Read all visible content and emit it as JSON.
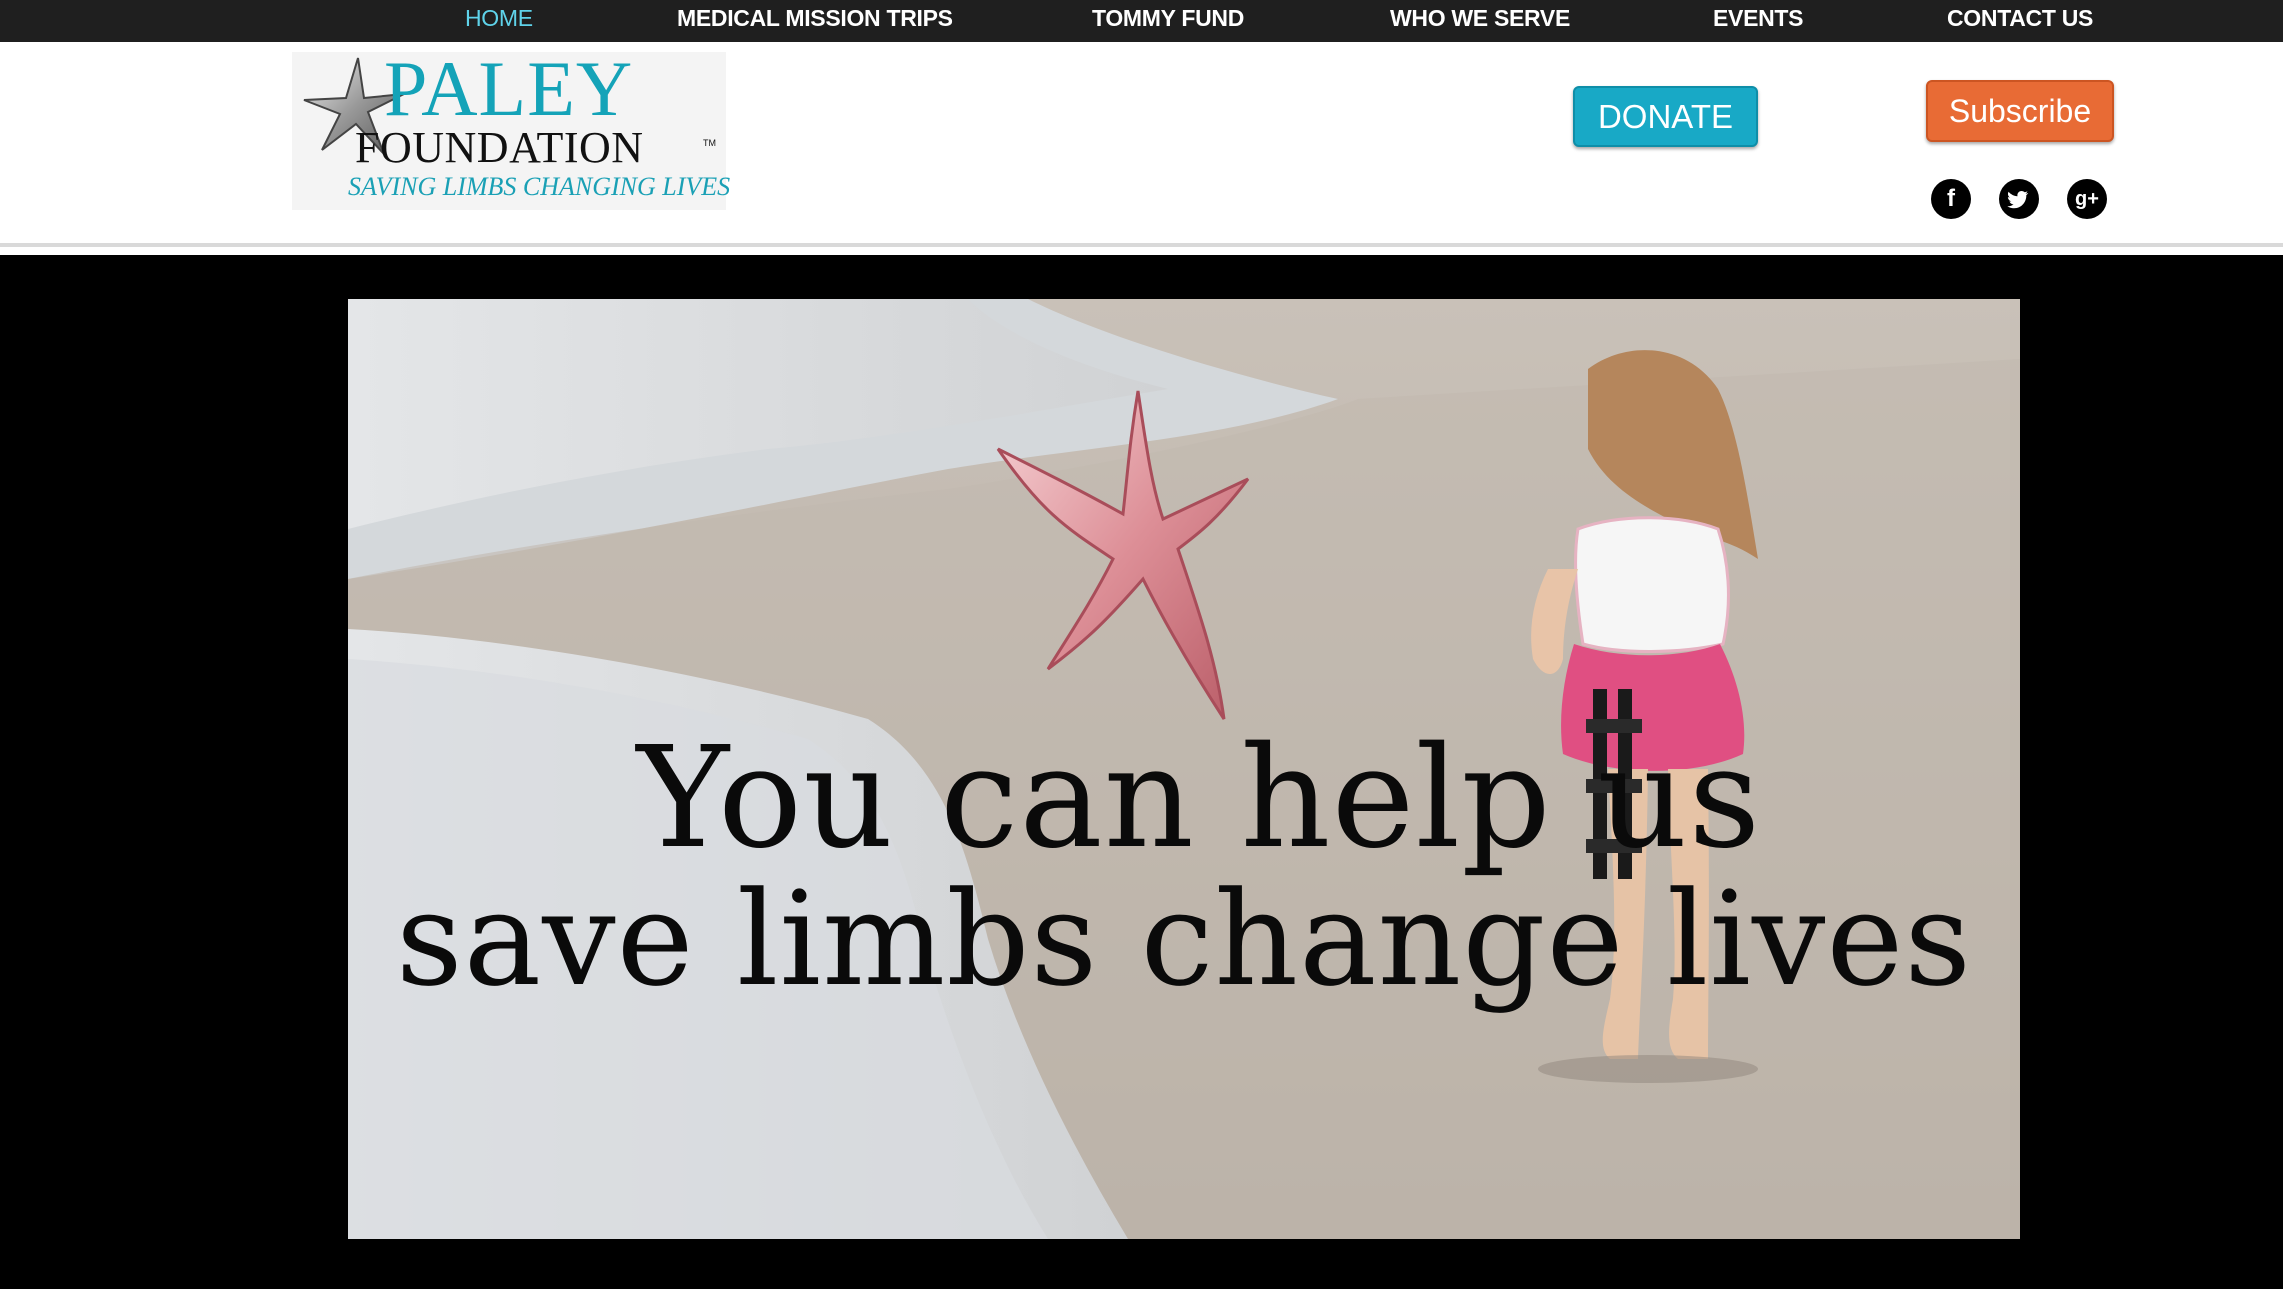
{
  "nav": {
    "items": [
      {
        "label": "HOME",
        "active": true
      },
      {
        "label": "MEDICAL MISSION TRIPS",
        "active": false
      },
      {
        "label": "TOMMY FUND",
        "active": false
      },
      {
        "label": "WHO WE SERVE",
        "active": false
      },
      {
        "label": "EVENTS",
        "active": false
      },
      {
        "label": "CONTACT US",
        "active": false
      }
    ]
  },
  "logo": {
    "name": "PALEY",
    "subname": "FOUNDATION",
    "tm": "TM",
    "tagline": "SAVING LIMBS CHANGING LIVES"
  },
  "header": {
    "donate_label": "DONATE",
    "subscribe_label": "Subscribe"
  },
  "social": {
    "facebook": "f",
    "twitter": "t",
    "googleplus": "g+"
  },
  "hero": {
    "line1": "You can help us",
    "line2": "save limbs change lives"
  },
  "colors": {
    "nav_bg": "#1f1f1f",
    "nav_active": "#5fd3ea",
    "donate": "#18a9c6",
    "subscribe": "#e86b35",
    "brand_teal": "#14a3b8"
  }
}
